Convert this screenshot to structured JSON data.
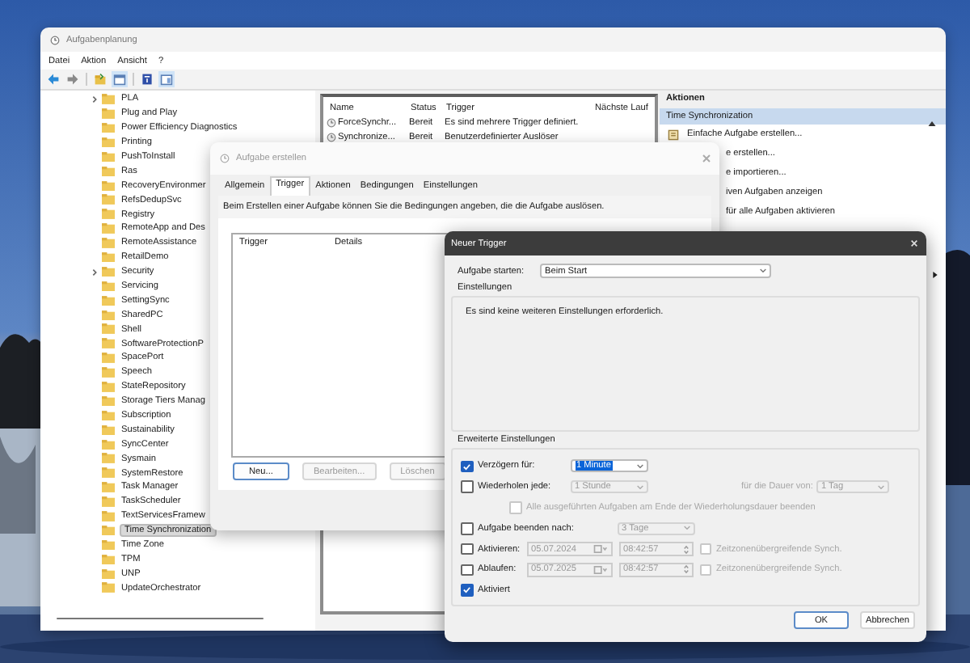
{
  "main_window": {
    "title": "Aufgabenplanung",
    "menu": [
      "Datei",
      "Aktion",
      "Ansicht",
      "?"
    ],
    "tree": {
      "items": [
        {
          "label": "PLA",
          "expandable": true,
          "selected": false
        },
        {
          "label": "Plug and Play",
          "expandable": false,
          "selected": false
        },
        {
          "label": "Power Efficiency Diagnostics",
          "expandable": false,
          "selected": false
        },
        {
          "label": "Printing",
          "expandable": false,
          "selected": false
        },
        {
          "label": "PushToInstall",
          "expandable": false,
          "selected": false
        },
        {
          "label": "Ras",
          "expandable": false,
          "selected": false
        },
        {
          "label": "RecoveryEnvironmer",
          "expandable": false,
          "selected": false
        },
        {
          "label": "RefsDedupSvc",
          "expandable": false,
          "selected": false
        },
        {
          "label": "Registry",
          "expandable": false,
          "selected": false
        },
        {
          "label": "RemoteApp and Des",
          "expandable": false,
          "selected": false
        },
        {
          "label": "RemoteAssistance",
          "expandable": false,
          "selected": false
        },
        {
          "label": "RetailDemo",
          "expandable": false,
          "selected": false
        },
        {
          "label": "Security",
          "expandable": true,
          "selected": false
        },
        {
          "label": "Servicing",
          "expandable": false,
          "selected": false
        },
        {
          "label": "SettingSync",
          "expandable": false,
          "selected": false
        },
        {
          "label": "SharedPC",
          "expandable": false,
          "selected": false
        },
        {
          "label": "Shell",
          "expandable": false,
          "selected": false
        },
        {
          "label": "SoftwareProtectionP",
          "expandable": false,
          "selected": false
        },
        {
          "label": "SpacePort",
          "expandable": false,
          "selected": false
        },
        {
          "label": "Speech",
          "expandable": false,
          "selected": false
        },
        {
          "label": "StateRepository",
          "expandable": false,
          "selected": false
        },
        {
          "label": "Storage Tiers Manag",
          "expandable": false,
          "selected": false
        },
        {
          "label": "Subscription",
          "expandable": false,
          "selected": false
        },
        {
          "label": "Sustainability",
          "expandable": false,
          "selected": false
        },
        {
          "label": "SyncCenter",
          "expandable": false,
          "selected": false
        },
        {
          "label": "Sysmain",
          "expandable": false,
          "selected": false
        },
        {
          "label": "SystemRestore",
          "expandable": false,
          "selected": false
        },
        {
          "label": "Task Manager",
          "expandable": false,
          "selected": false
        },
        {
          "label": "TaskScheduler",
          "expandable": false,
          "selected": false
        },
        {
          "label": "TextServicesFramew",
          "expandable": false,
          "selected": false
        },
        {
          "label": "Time Synchronization",
          "expandable": false,
          "selected": true
        },
        {
          "label": "Time Zone",
          "expandable": false,
          "selected": false
        },
        {
          "label": "TPM",
          "expandable": false,
          "selected": false
        },
        {
          "label": "UNP",
          "expandable": false,
          "selected": false
        },
        {
          "label": "UpdateOrchestrator",
          "expandable": false,
          "selected": false
        }
      ]
    },
    "task_table": {
      "columns": [
        "Name",
        "Status",
        "Trigger",
        "Nächste Lauf"
      ],
      "rows": [
        {
          "name": "ForceSynchr...",
          "status": "Bereit",
          "trigger": "Es sind mehrere Trigger definiert."
        },
        {
          "name": "Synchronize...",
          "status": "Bereit",
          "trigger": "Benutzerdefinierter Auslöser"
        }
      ]
    },
    "actions_pane": {
      "title": "Aktionen",
      "section": "Time Synchronization",
      "items": [
        {
          "label": "Einfache Aufgabe erstellen...",
          "partial": false
        },
        {
          "label": "e erstellen...",
          "partial": true
        },
        {
          "label": "e importieren...",
          "partial": true
        },
        {
          "label": "iven Aufgaben anzeigen",
          "partial": true
        },
        {
          "label": "für alle Aufgaben aktivieren",
          "partial": true
        }
      ]
    }
  },
  "create_task_dialog": {
    "title": "Aufgabe erstellen",
    "tabs": [
      {
        "label": "Allgemein",
        "selected": false
      },
      {
        "label": "Trigger",
        "selected": true
      },
      {
        "label": "Aktionen",
        "selected": false
      },
      {
        "label": "Bedingungen",
        "selected": false
      },
      {
        "label": "Einstellungen",
        "selected": false
      }
    ],
    "description": "Beim Erstellen einer Aufgabe können Sie die Bedingungen angeben, die die Aufgabe auslösen.",
    "list_columns": [
      "Trigger",
      "Details"
    ],
    "buttons": [
      {
        "label": "Neu...",
        "disabled": false,
        "focused": true
      },
      {
        "label": "Bearbeiten...",
        "disabled": true,
        "focused": false
      },
      {
        "label": "Löschen",
        "disabled": true,
        "focused": false
      }
    ]
  },
  "new_trigger_dialog": {
    "title": "Neuer Trigger",
    "start_label": "Aufgabe starten:",
    "start_value": "Beim Start",
    "settings_title": "Einstellungen",
    "settings_text": "Es sind keine weiteren Einstellungen erforderlich.",
    "advanced_title": "Erweiterte Einstellungen",
    "delay": {
      "label": "Verzögern für:",
      "checked": true,
      "value": "1 Minute",
      "focused": true
    },
    "repeat": {
      "label": "Wiederholen jede:",
      "checked": false,
      "value": "1 Stunde",
      "duration_label": "für die Dauer von:",
      "duration_value": "1 Tag",
      "stop_all_label": "Alle ausgeführten Aufgaben am Ende der Wiederholungsdauer beenden",
      "stop_all_checked": false
    },
    "stop_after": {
      "label": "Aufgabe beenden nach:",
      "checked": false,
      "value": "3 Tage"
    },
    "activate": {
      "label": "Aktivieren:",
      "checked": false,
      "date": "05.07.2024",
      "time": "08:42:57",
      "sync_label": "Zeitzonenübergreifende Synch.",
      "sync_checked": false
    },
    "expire": {
      "label": "Ablaufen:",
      "checked": false,
      "date": "05.07.2025",
      "time": "08:42:57",
      "sync_label": "Zeitzonenübergreifende Synch.",
      "sync_checked": false
    },
    "enabled": {
      "label": "Aktiviert",
      "checked": true
    },
    "buttons": [
      {
        "label": "OK",
        "default": true
      },
      {
        "label": "Abbrechen",
        "default": false
      }
    ]
  }
}
